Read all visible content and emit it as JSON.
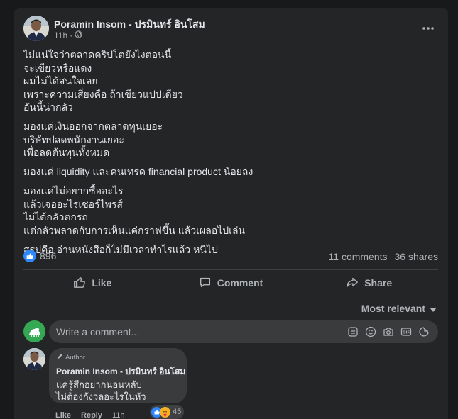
{
  "post": {
    "author": "Poramin Insom - ปรมินทร์ อินโสม",
    "time": "11h",
    "privacy_icon": "globe-icon",
    "paragraphs": [
      [
        "ไม่แน่ใจว่าตลาดคริปโตยังไงตอนนี้",
        "จะเขียวหรือแดง",
        "ผมไม่ได้สนใจเลย",
        "เพราะความเสี่ยงคือ ถ้าเขียวแปปเดียว",
        "อันนี้น่ากลัว"
      ],
      [
        "มองแค่เงินออกจากตลาดทุนเยอะ",
        "บริษัทปลดพนักงานเยอะ",
        "เพื่อลดต้นทุนทั้งหมด"
      ],
      [
        "มองแค่ liquidity และคนเทรด financial product น้อยลง"
      ],
      [
        "มองแค่ไม่อยากซื้ออะไร",
        "แล้วเจออะไรเซอร์ไพรส์",
        "ไม่ได้กลัวตกรถ",
        "แต่กลัวพลาดกับการเห็นแค่กราฟขึ้น แล้วเผลอไปเล่น"
      ],
      [
        "สรุปคือ อ่านหนังสือก็ไม่มีเวลาทำไรแล้ว หนีไป"
      ]
    ]
  },
  "stats": {
    "reactions": "896",
    "comments": "11 comments",
    "shares": "36 shares"
  },
  "actions": {
    "like": "Like",
    "comment": "Comment",
    "share": "Share"
  },
  "sort_label": "Most relevant",
  "composer": {
    "placeholder": "Write a comment..."
  },
  "comment": {
    "badge": "Author",
    "name": "Poramin Insom - ปรมินทร์ อินโสม",
    "lines": [
      "แค่รู้สึกอยากนอนหลับ",
      "ไม่ต้องกังวลอะไรในหัว"
    ],
    "like": "Like",
    "reply": "Reply",
    "time": "11h",
    "reactions": "45"
  },
  "colors": {
    "background": "#18191a",
    "card": "#242526",
    "accent": "#2d88ff",
    "bubble": "#3a3b3c"
  }
}
